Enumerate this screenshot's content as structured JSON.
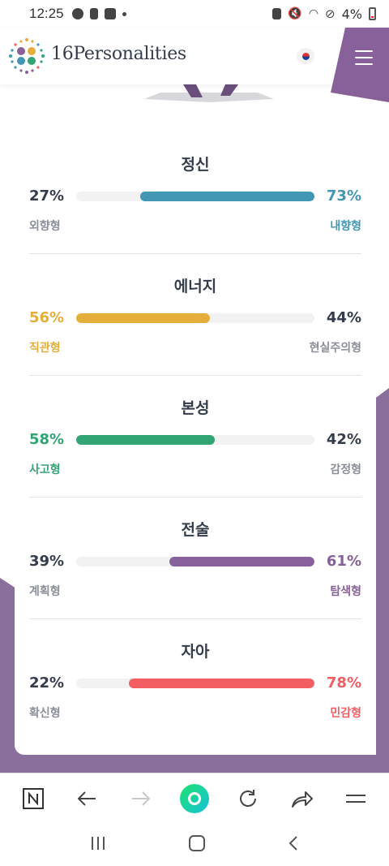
{
  "status_bar": {
    "time": "12:25",
    "battery": "4%"
  },
  "header": {
    "brand": "16Personalities",
    "icons": [
      "16personalities-logo-icon",
      "korean-flag-icon",
      "hamburger-menu-icon"
    ]
  },
  "traits": [
    {
      "label": "정신",
      "left_pct": "27%",
      "right_pct": "73%",
      "left_name": "외향형",
      "right_name": "내향형",
      "color": "#4298b4",
      "dominant": "right",
      "fill_fraction": 0.73
    },
    {
      "label": "에너지",
      "left_pct": "56%",
      "right_pct": "44%",
      "left_name": "직관형",
      "right_name": "현실주의형",
      "color": "#e4ae3a",
      "dominant": "left",
      "fill_fraction": 0.56
    },
    {
      "label": "본성",
      "left_pct": "58%",
      "right_pct": "42%",
      "left_name": "사고형",
      "right_name": "감정형",
      "color": "#33a474",
      "dominant": "left",
      "fill_fraction": 0.58
    },
    {
      "label": "전술",
      "left_pct": "39%",
      "right_pct": "61%",
      "left_name": "계획형",
      "right_name": "탐색형",
      "color": "#88619a",
      "dominant": "right",
      "fill_fraction": 0.61
    },
    {
      "label": "자아",
      "left_pct": "22%",
      "right_pct": "78%",
      "left_name": "확신형",
      "right_name": "민감형",
      "color": "#f25e62",
      "dominant": "right",
      "fill_fraction": 0.78
    }
  ],
  "colors": {
    "text_dark": "#343c4b",
    "text_muted": "#8a8f98",
    "brand_purple": "#88619a"
  },
  "browser_toolbar": {
    "icons": [
      "naver-n-icon",
      "back-arrow-icon",
      "forward-arrow-icon",
      "green-search-icon",
      "reload-icon",
      "share-icon",
      "menu-lines-icon"
    ]
  },
  "nav_bar": {
    "icons": [
      "recent-apps-icon",
      "home-icon",
      "back-icon"
    ]
  }
}
